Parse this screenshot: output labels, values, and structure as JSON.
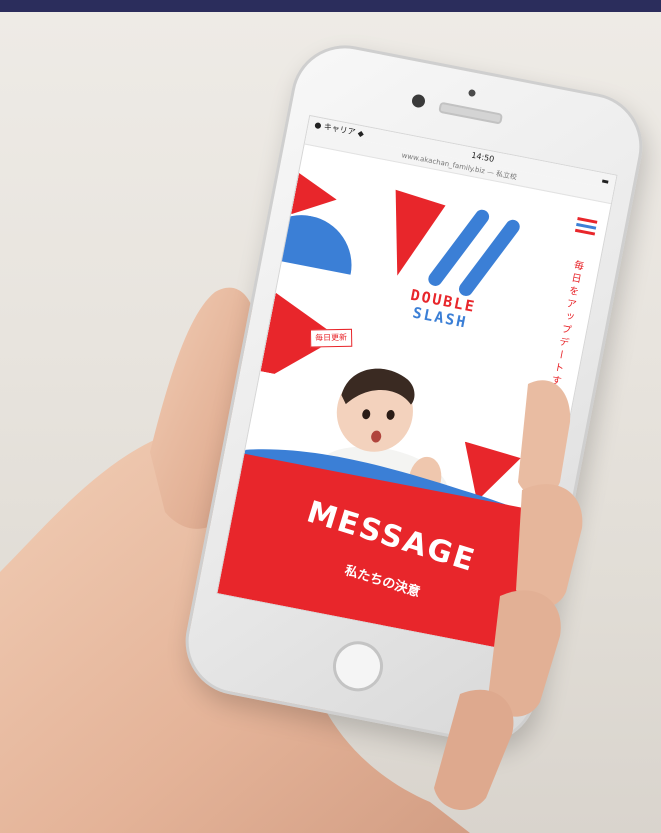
{
  "status_bar": {
    "left": "● キャリア ◆",
    "time": "14:50",
    "right": "▬"
  },
  "browser": {
    "url": "www.akachan_family.biz — 私立校"
  },
  "site": {
    "logo": {
      "line1": "DOUBLE",
      "line2": "SLASH"
    },
    "tagline_vertical": "毎日をアップデートする",
    "badge": "毎日更新",
    "message": {
      "title": "MESSAGE",
      "subtitle": "私たちの決意"
    }
  },
  "colors": {
    "brand_red": "#e8262b",
    "brand_blue": "#3b7fd6",
    "frame": "#2b2d5c"
  }
}
